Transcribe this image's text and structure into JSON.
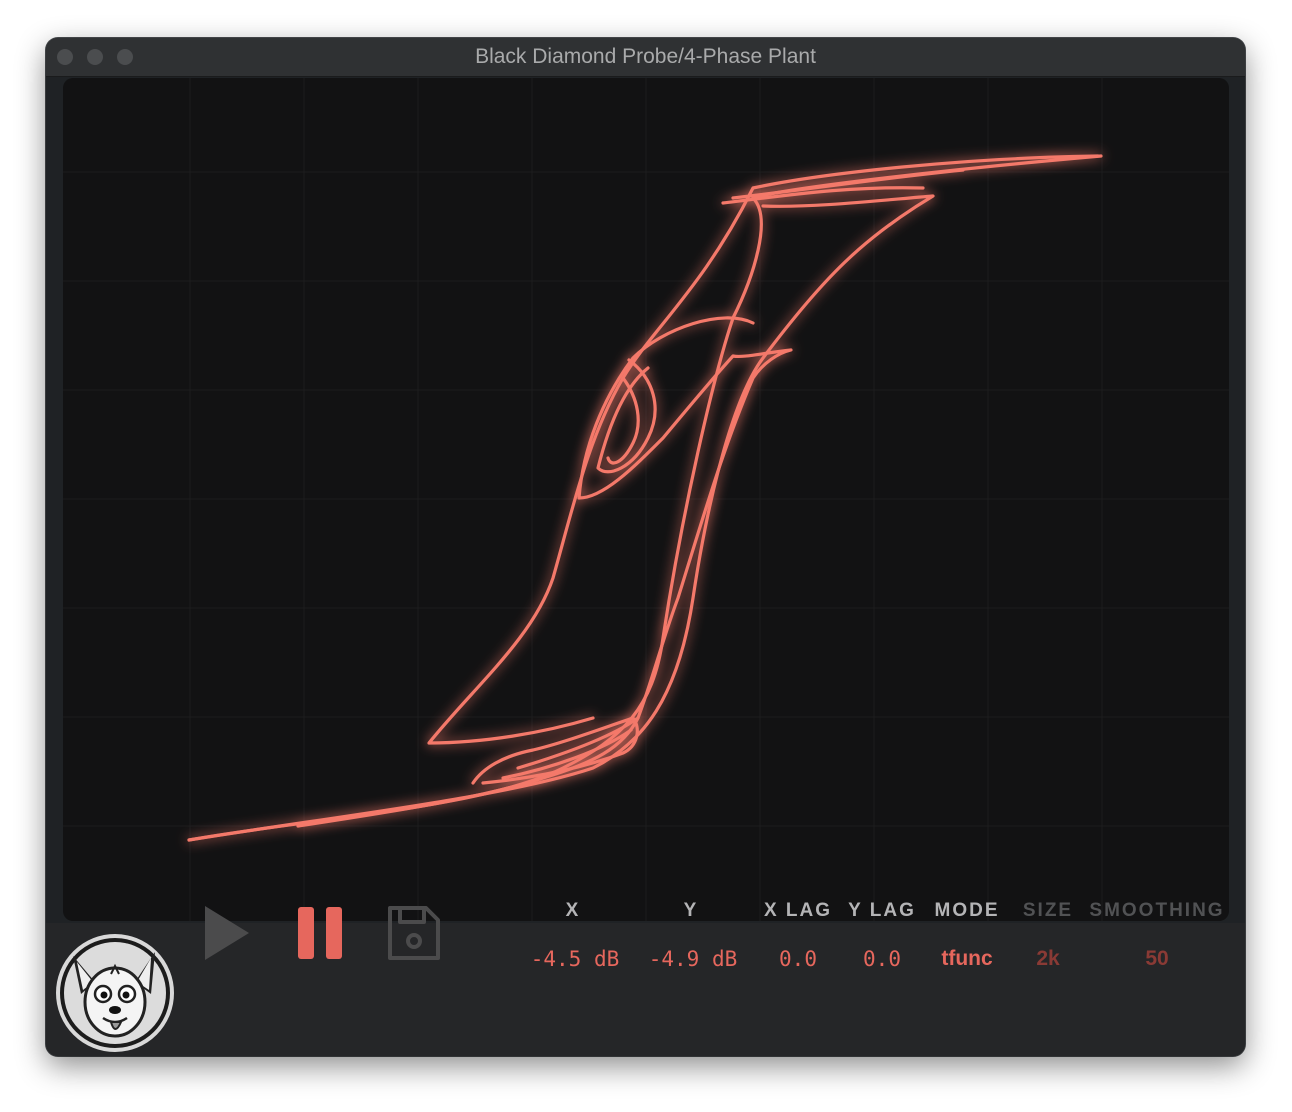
{
  "window": {
    "title": "Black Diamond Probe/4-Phase Plant"
  },
  "colors": {
    "trace": "#f4796b",
    "background": "#121213",
    "accent": "#e6675d"
  },
  "icons": {
    "play": "play-icon",
    "pause": "pause-icon",
    "save": "floppy-disk-icon",
    "logo": "dog-mascot-logo"
  },
  "controls": {
    "x": {
      "label": "X",
      "value": "-4.5 dB"
    },
    "y": {
      "label": "Y",
      "value": "-4.9 dB"
    },
    "x_lag": {
      "label": "X LAG",
      "value": "0.0"
    },
    "y_lag": {
      "label": "Y LAG",
      "value": "0.0"
    },
    "mode": {
      "label": "MODE",
      "value": "tfunc"
    },
    "size": {
      "label": "SIZE",
      "value": "2k"
    },
    "smoothing": {
      "label": "SMOOTHING",
      "value": "50"
    }
  }
}
